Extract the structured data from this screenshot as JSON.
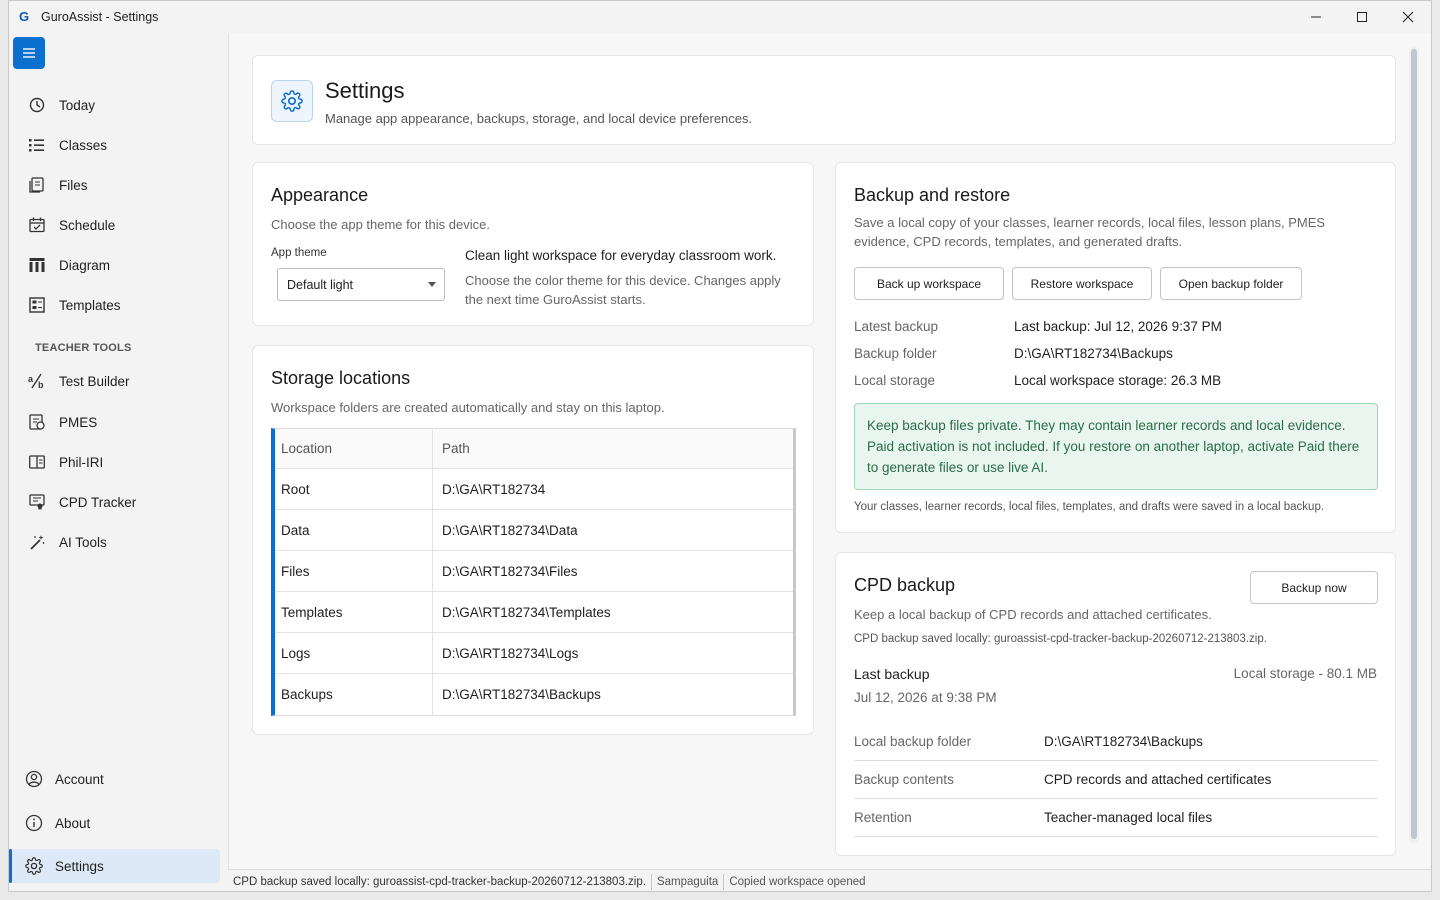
{
  "window": {
    "title": "GuroAssist - Settings",
    "app_icon": "G"
  },
  "sidebar": {
    "items": [
      {
        "label": "Today",
        "icon": "clock-icon"
      },
      {
        "label": "Classes",
        "icon": "list-icon"
      },
      {
        "label": "Files",
        "icon": "files-icon"
      },
      {
        "label": "Schedule",
        "icon": "calendar-icon"
      },
      {
        "label": "Diagram",
        "icon": "diagram-icon"
      },
      {
        "label": "Templates",
        "icon": "templates-icon"
      }
    ],
    "section_label": "TEACHER TOOLS",
    "tools": [
      {
        "label": "Test Builder",
        "icon": "test-builder-icon"
      },
      {
        "label": "PMES",
        "icon": "pmes-icon"
      },
      {
        "label": "Phil-IRI",
        "icon": "book-icon"
      },
      {
        "label": "CPD Tracker",
        "icon": "cpd-icon"
      },
      {
        "label": "AI Tools",
        "icon": "magic-wand-icon"
      }
    ],
    "bottom": [
      {
        "label": "Account",
        "icon": "account-icon"
      },
      {
        "label": "About",
        "icon": "info-icon"
      },
      {
        "label": "Settings",
        "icon": "gear-icon"
      }
    ]
  },
  "header": {
    "title": "Settings",
    "subtitle": "Manage app appearance, backups, storage, and local device preferences."
  },
  "appearance": {
    "title": "Appearance",
    "subtitle": "Choose the app theme for this device.",
    "field_label": "App theme",
    "selected": "Default light",
    "theme_desc": "Clean light workspace for everyday classroom work.",
    "theme_note": "Choose the color theme for this device. Changes apply the next time GuroAssist starts."
  },
  "storage": {
    "title": "Storage locations",
    "subtitle": "Workspace folders are created automatically and stay on this laptop.",
    "headers": [
      "Location",
      "Path"
    ],
    "rows": [
      [
        "Root",
        "D:\\GA\\RT182734"
      ],
      [
        "Data",
        "D:\\GA\\RT182734\\Data"
      ],
      [
        "Files",
        "D:\\GA\\RT182734\\Files"
      ],
      [
        "Templates",
        "D:\\GA\\RT182734\\Templates"
      ],
      [
        "Logs",
        "D:\\GA\\RT182734\\Logs"
      ],
      [
        "Backups",
        "D:\\GA\\RT182734\\Backups"
      ]
    ]
  },
  "backup": {
    "title": "Backup and restore",
    "description": "Save a local copy of your classes, learner records, local files, lesson plans, PMES evidence, CPD records, templates, and generated drafts.",
    "buttons": [
      "Back up workspace",
      "Restore workspace",
      "Open backup folder"
    ],
    "info": [
      {
        "key": "Latest backup",
        "value": "Last backup: Jul 12, 2026 9:37 PM"
      },
      {
        "key": "Backup folder",
        "value": "D:\\GA\\RT182734\\Backups"
      },
      {
        "key": "Local storage",
        "value": "Local workspace storage: 26.3 MB"
      }
    ],
    "notice": "Keep backup files private. They may contain learner records and local evidence. Paid activation is not included. If you restore on another laptop, activate Paid there to generate files or use live AI.",
    "footer": "Your classes, learner records, local files, templates, and drafts were saved in a local backup."
  },
  "cpd": {
    "title": "CPD backup",
    "subtitle": "Keep a local backup of CPD records and attached certificates.",
    "button": "Backup now",
    "saved": "CPD backup saved locally: guroassist-cpd-tracker-backup-20260712-213803.zip.",
    "last_backup_label": "Last backup",
    "last_backup_date": "Jul 12, 2026 at 9:38 PM",
    "local_storage": "Local storage - 80.1 MB",
    "rows": [
      {
        "key": "Local backup folder",
        "value": "D:\\GA\\RT182734\\Backups"
      },
      {
        "key": "Backup contents",
        "value": "CPD records and attached certificates"
      },
      {
        "key": "Retention",
        "value": "Teacher-managed local files"
      }
    ]
  },
  "statusbar": {
    "message": "CPD backup saved locally: guroassist-cpd-tracker-backup-20260712-213803.zip.",
    "theme": "Sampaguita",
    "event": "Copied workspace opened"
  },
  "colors": {
    "accent": "#0b6fd0",
    "notice_bg": "#e9f6ef",
    "notice_text": "#2b6b4a"
  }
}
